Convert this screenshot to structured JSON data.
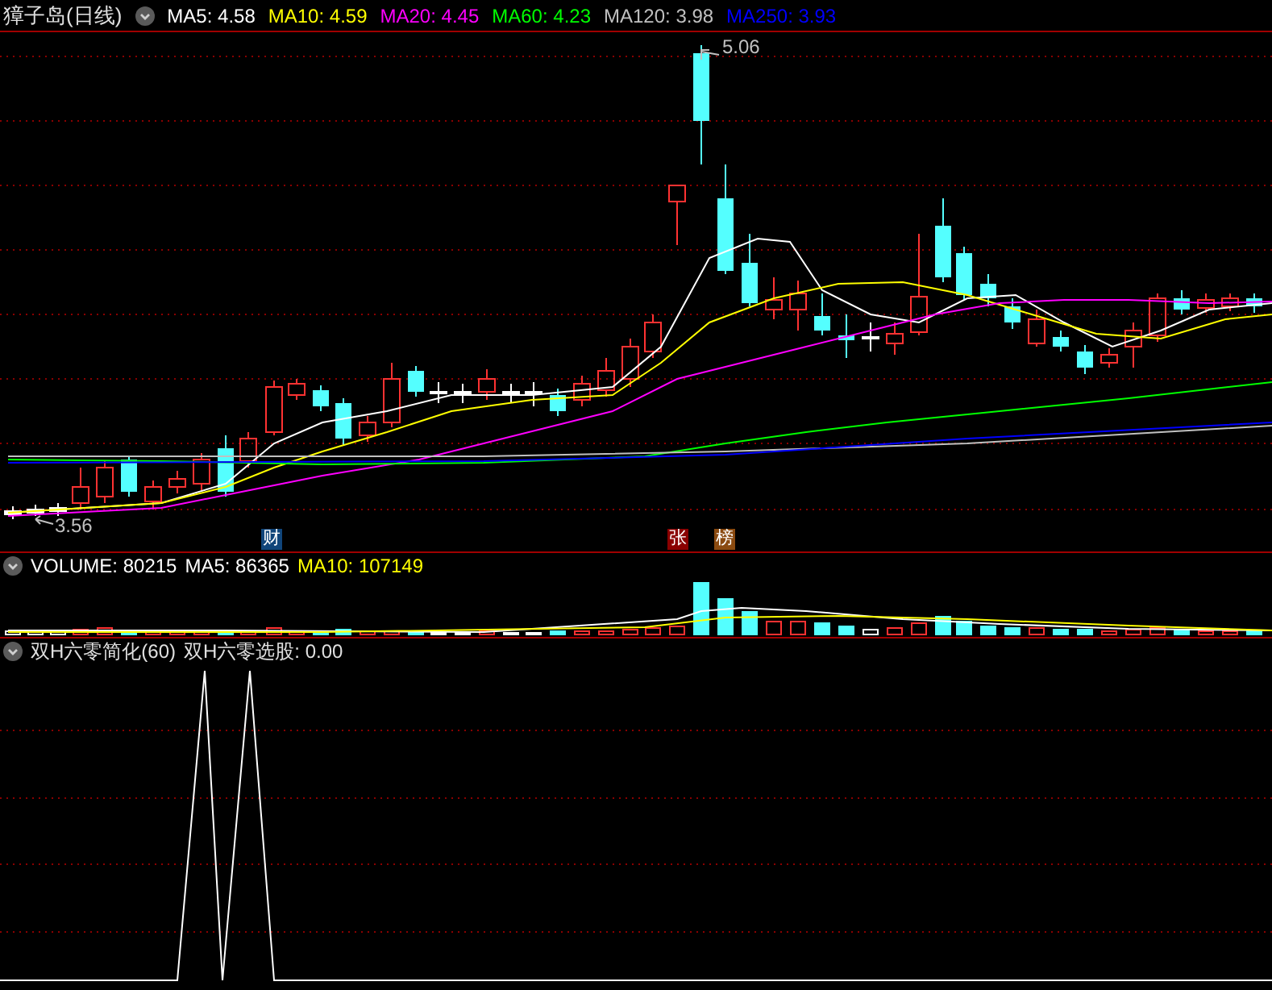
{
  "title": "獐子岛(日线)",
  "ma_legend": [
    {
      "label": "MA5: 4.58",
      "color": "#ffffff"
    },
    {
      "label": "MA10: 4.59",
      "color": "#ffff00"
    },
    {
      "label": "MA20: 4.45",
      "color": "#ff00ff"
    },
    {
      "label": "MA60: 4.23",
      "color": "#00ff00"
    },
    {
      "label": "MA120: 3.98",
      "color": "#c0c0c0"
    },
    {
      "label": "MA250: 3.93",
      "color": "#0000ff"
    }
  ],
  "high_label": "5.06",
  "low_label": "3.56",
  "event_markers": [
    {
      "label": "财",
      "color": "#10457a"
    },
    {
      "label": "张",
      "color": "#8a0000"
    },
    {
      "label": "榜",
      "color": "#8a4a10"
    }
  ],
  "volume_legend": [
    {
      "label": "VOLUME: 80215",
      "color": "#ffffff"
    },
    {
      "label": "MA5: 86365",
      "color": "#ffffff"
    },
    {
      "label": "MA10: 107149",
      "color": "#ffff00"
    }
  ],
  "indicator_legend": [
    {
      "label": "双H六零简化(60)"
    },
    {
      "label": "双H六零选股: 0.00"
    }
  ]
}
